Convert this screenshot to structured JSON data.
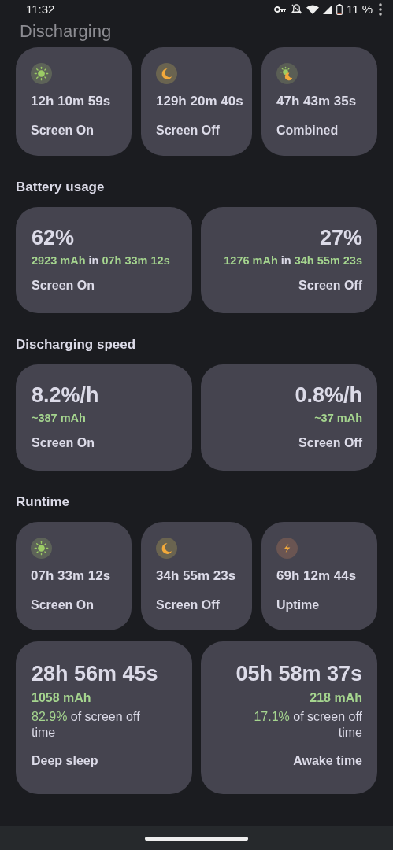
{
  "status_bar": {
    "time": "11:32",
    "battery": "11 %"
  },
  "app_bar": {
    "title": "Discharging"
  },
  "summary": [
    {
      "kind": "sun",
      "value": "12h 10m 59s",
      "label": "Screen On"
    },
    {
      "kind": "moon",
      "value": "129h 20m 40s",
      "label": "Screen Off"
    },
    {
      "kind": "combined",
      "value": "47h 43m 35s",
      "label": "Combined"
    }
  ],
  "battery_usage": {
    "title": "Battery usage",
    "cards": [
      {
        "percent": "62%",
        "mah": "2923 mAh",
        "connector": "in",
        "duration": "07h 33m 12s",
        "label": "Screen On"
      },
      {
        "percent": "27%",
        "mah": "1276 mAh",
        "connector": "in",
        "duration": "34h 55m 23s",
        "label": "Screen Off"
      }
    ]
  },
  "discharging_speed": {
    "title": "Discharging speed",
    "cards": [
      {
        "rate": "8.2%/h",
        "mah": "~387 mAh",
        "label": "Screen On"
      },
      {
        "rate": "0.8%/h",
        "mah": "~37 mAh",
        "label": "Screen Off"
      }
    ]
  },
  "runtime": {
    "title": "Runtime",
    "small_cards": [
      {
        "kind": "sun",
        "value": "07h 33m 12s",
        "label": "Screen On"
      },
      {
        "kind": "moon",
        "value": "34h 55m 23s",
        "label": "Screen Off"
      },
      {
        "kind": "bolt",
        "value": "69h 12m 44s",
        "label": "Uptime"
      }
    ],
    "large_cards": [
      {
        "value": "28h 56m 45s",
        "mah": "1058 mAh",
        "share": "82.9%",
        "share_text": "of screen off time",
        "label": "Deep sleep"
      },
      {
        "value": "05h 58m 37s",
        "mah": "218 mAh",
        "share": "17.1%",
        "share_text": "of screen off time",
        "label": "Awake time"
      }
    ]
  }
}
